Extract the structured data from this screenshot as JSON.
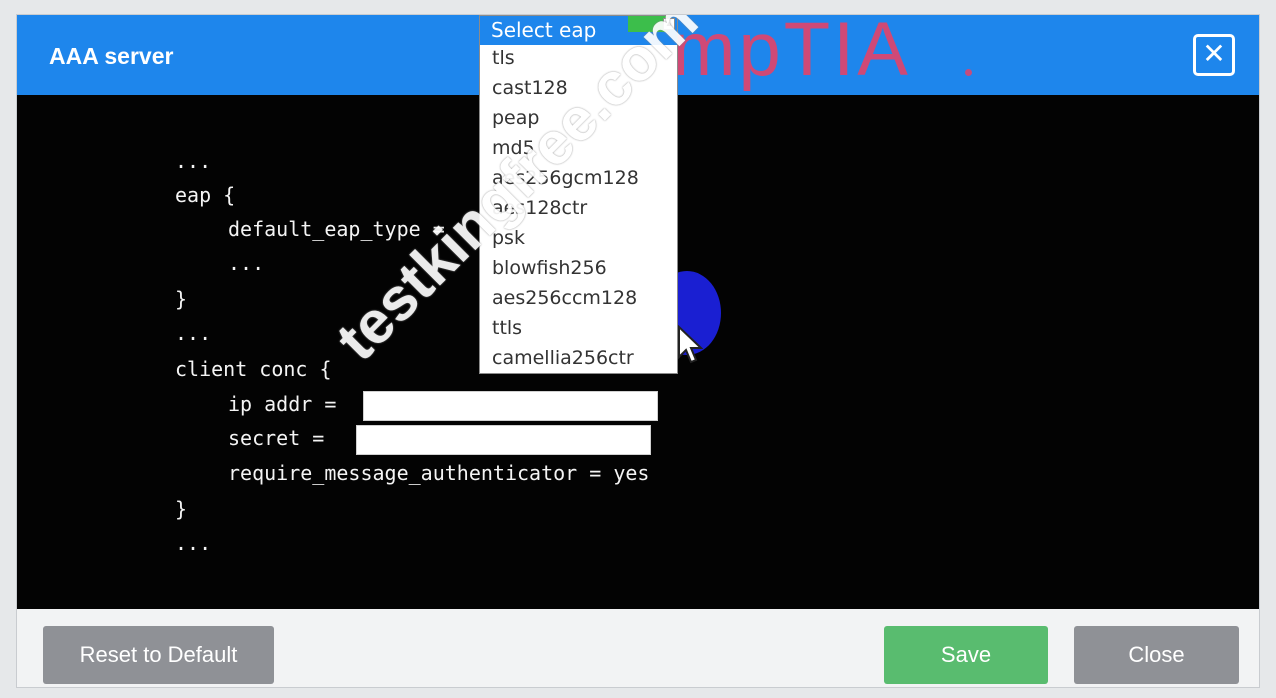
{
  "dialog": {
    "title": "AAA server",
    "close_glyph": "✕",
    "brand_logo": "CompTIA"
  },
  "code": {
    "lines": [
      "...",
      "eap {",
      "default_eap_type =",
      "...",
      "}",
      "...",
      "client conc {",
      "ip addr =",
      "secret =",
      "require_message_authenticator = yes",
      "}",
      "..."
    ]
  },
  "fields": {
    "ip_addr": {
      "value": ""
    },
    "secret": {
      "value": ""
    }
  },
  "eap_dropdown": {
    "selected_label": "Select eap",
    "options": [
      "tls",
      "cast128",
      "peap",
      "md5",
      "aes256gcm128",
      "aes128ctr",
      "psk",
      "blowfish256",
      "aes256ccm128",
      "ttls",
      "camellia256ctr"
    ]
  },
  "footer": {
    "reset_label": "Reset to Default",
    "save_label": "Save",
    "close_label": "Close"
  },
  "watermark": "testkingfree.com",
  "colors": {
    "title_bar": "#1e86ec",
    "code_bg": "#030303",
    "save_button": "#59bc6f",
    "neutral_button": "#8f9196",
    "logo": "#ee3f62"
  }
}
